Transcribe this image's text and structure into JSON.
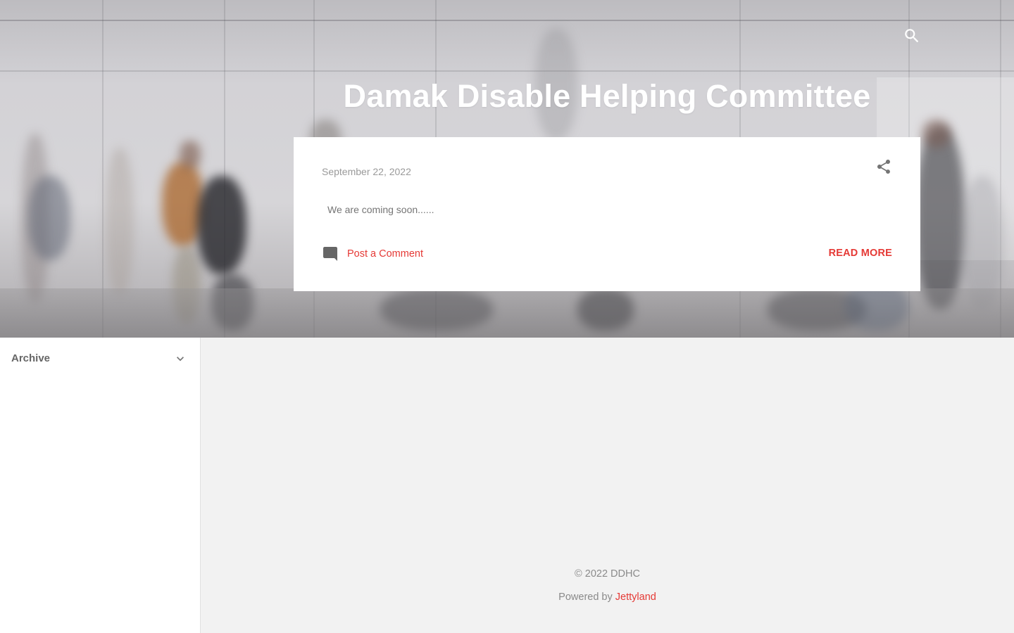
{
  "header": {
    "blog_title": "Damak Disable Helping Committee",
    "search_icon": "search-icon"
  },
  "post": {
    "date": "September 22, 2022",
    "snippet": "We are coming soon......",
    "comment_label": "Post a Comment",
    "read_more_label": "READ MORE",
    "share_icon": "share-icon",
    "comment_icon": "comment-icon"
  },
  "sidebar": {
    "archive_title": "Archive",
    "chevron_icon": "chevron-down-icon"
  },
  "footer": {
    "copyright": "© 2022 DDHC",
    "powered_prefix": "Powered by ",
    "powered_link": "Jettyland"
  },
  "colors": {
    "accent": "#e53935",
    "muted_text": "#8a8a8a",
    "page_bg": "#f2f2f2",
    "card_bg": "#ffffff"
  }
}
